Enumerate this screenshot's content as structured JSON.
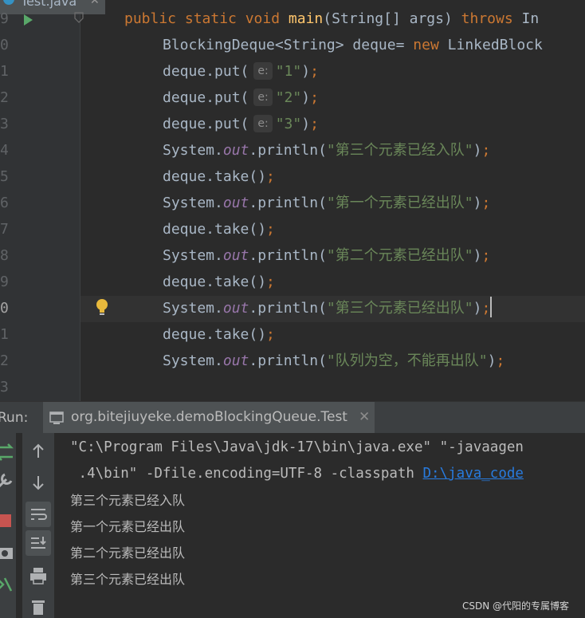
{
  "editor": {
    "tab": {
      "label": "Test.java",
      "close": "✕"
    },
    "lines": [
      {
        "num": "9",
        "parts": [
          {
            "t": "kw",
            "v": "public static void "
          },
          {
            "t": "fn",
            "v": "main"
          },
          {
            "t": "",
            "v": "(String[] args) "
          },
          {
            "t": "kw",
            "v": "throws "
          },
          {
            "t": "",
            "v": "In"
          }
        ]
      },
      {
        "num": "0",
        "parts": [
          {
            "t": "",
            "v": "BlockingDeque<String> deque= "
          },
          {
            "t": "kw",
            "v": "new "
          },
          {
            "t": "",
            "v": "LinkedBlock"
          }
        ]
      },
      {
        "num": "1",
        "parts": [
          {
            "t": "",
            "v": "deque.put("
          },
          {
            "t": "hint",
            "v": "e:"
          },
          {
            "t": "str",
            "v": "\"1\""
          },
          {
            "t": "",
            "v": ")"
          },
          {
            "t": "semi",
            "v": ";"
          }
        ]
      },
      {
        "num": "2",
        "parts": [
          {
            "t": "",
            "v": "deque.put("
          },
          {
            "t": "hint",
            "v": "e:"
          },
          {
            "t": "str",
            "v": "\"2\""
          },
          {
            "t": "",
            "v": ")"
          },
          {
            "t": "semi",
            "v": ";"
          }
        ]
      },
      {
        "num": "3",
        "parts": [
          {
            "t": "",
            "v": "deque.put("
          },
          {
            "t": "hint",
            "v": "e:"
          },
          {
            "t": "str",
            "v": "\"3\""
          },
          {
            "t": "",
            "v": ")"
          },
          {
            "t": "semi",
            "v": ";"
          }
        ]
      },
      {
        "num": "4",
        "parts": [
          {
            "t": "",
            "v": "System."
          },
          {
            "t": "fld",
            "v": "out"
          },
          {
            "t": "",
            "v": ".println("
          },
          {
            "t": "str",
            "v": "\"第三个元素已经入队\""
          },
          {
            "t": "",
            "v": ")"
          },
          {
            "t": "semi",
            "v": ";"
          }
        ]
      },
      {
        "num": "5",
        "parts": [
          {
            "t": "",
            "v": "deque.take()"
          },
          {
            "t": "semi",
            "v": ";"
          }
        ]
      },
      {
        "num": "6",
        "parts": [
          {
            "t": "",
            "v": "System."
          },
          {
            "t": "fld",
            "v": "out"
          },
          {
            "t": "",
            "v": ".println("
          },
          {
            "t": "str",
            "v": "\"第一个元素已经出队\""
          },
          {
            "t": "",
            "v": ")"
          },
          {
            "t": "semi",
            "v": ";"
          }
        ]
      },
      {
        "num": "7",
        "parts": [
          {
            "t": "",
            "v": "deque.take()"
          },
          {
            "t": "semi",
            "v": ";"
          }
        ]
      },
      {
        "num": "8",
        "parts": [
          {
            "t": "",
            "v": "System."
          },
          {
            "t": "fld",
            "v": "out"
          },
          {
            "t": "",
            "v": ".println("
          },
          {
            "t": "str",
            "v": "\"第二个元素已经出队\""
          },
          {
            "t": "",
            "v": ")"
          },
          {
            "t": "semi",
            "v": ";"
          }
        ]
      },
      {
        "num": "9",
        "parts": [
          {
            "t": "",
            "v": "deque.take()"
          },
          {
            "t": "semi",
            "v": ";"
          }
        ]
      },
      {
        "num": "0",
        "parts": [
          {
            "t": "",
            "v": "System."
          },
          {
            "t": "fld",
            "v": "out"
          },
          {
            "t": "",
            "v": ".println("
          },
          {
            "t": "str",
            "v": "\"第三个元素已经出队\""
          },
          {
            "t": "",
            "v": ")"
          },
          {
            "t": "semi",
            "v": ";"
          },
          {
            "t": "caret",
            "v": ""
          }
        ]
      },
      {
        "num": "1",
        "parts": [
          {
            "t": "",
            "v": "deque.take()"
          },
          {
            "t": "semi",
            "v": ";"
          }
        ]
      },
      {
        "num": "2",
        "parts": [
          {
            "t": "",
            "v": "System."
          },
          {
            "t": "fld",
            "v": "out"
          },
          {
            "t": "",
            "v": ".println("
          },
          {
            "t": "str",
            "v": "\"队列为空，不能再出队\""
          },
          {
            "t": "",
            "v": ")"
          },
          {
            "t": "semi",
            "v": ";"
          }
        ]
      },
      {
        "num": "3",
        "parts": []
      }
    ]
  },
  "run": {
    "label": "Run:",
    "tab_label": "org.bitejiuyeke.demoBlockingQueue.Test",
    "tab_close": "✕"
  },
  "console": {
    "cmd_line1": "\"C:\\Program Files\\Java\\jdk-17\\bin\\java.exe\" \"-javaagen",
    "cmd_line2_prefix": " .4\\bin\" -Dfile.encoding=UTF-8 -classpath ",
    "cmd_line2_link": "D:\\java_code",
    "output": [
      "第三个元素已经入队",
      "第一个元素已经出队",
      "第二个元素已经出队",
      "第三个元素已经出队"
    ]
  },
  "watermark": "CSDN @代阳的专属博客"
}
